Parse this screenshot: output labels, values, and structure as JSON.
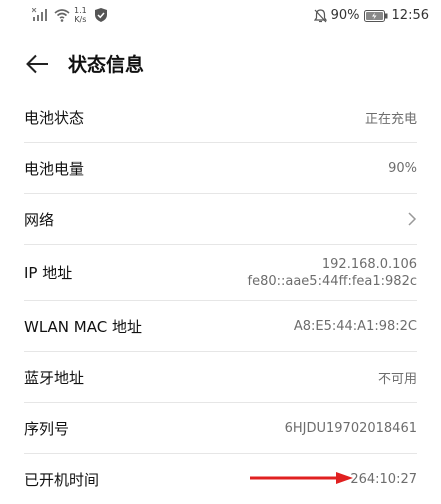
{
  "status_bar": {
    "speed_value": "1.1",
    "speed_unit": "K/s",
    "battery_percent": "90%",
    "time": "12:56",
    "icons": [
      "signal-icon",
      "wifi-icon",
      "shield-icon",
      "mute-icon",
      "battery-charging-icon"
    ]
  },
  "header": {
    "title": "状态信息",
    "back_icon": "back-arrow-icon"
  },
  "rows": [
    {
      "label": "电池状态",
      "value": "正在充电"
    },
    {
      "label": "电池电量",
      "value": "90%"
    },
    {
      "label": "网络",
      "value": ""
    },
    {
      "label": "IP 地址",
      "value_line1": "192.168.0.106",
      "value_line2": "fe80::aae5:44ff:fea1:982c"
    },
    {
      "label": "WLAN MAC 地址",
      "value": "A8:E5:44:A1:98:2C"
    },
    {
      "label": "蓝牙地址",
      "value": "不可用"
    },
    {
      "label": "序列号",
      "value": "6HJDU19702018461"
    },
    {
      "label": "已开机时间",
      "value": "264:10:27"
    }
  ],
  "colors": {
    "annotation_arrow": "#e02020",
    "divider": "#e6e6e6",
    "value_text": "#6d6d6d"
  }
}
